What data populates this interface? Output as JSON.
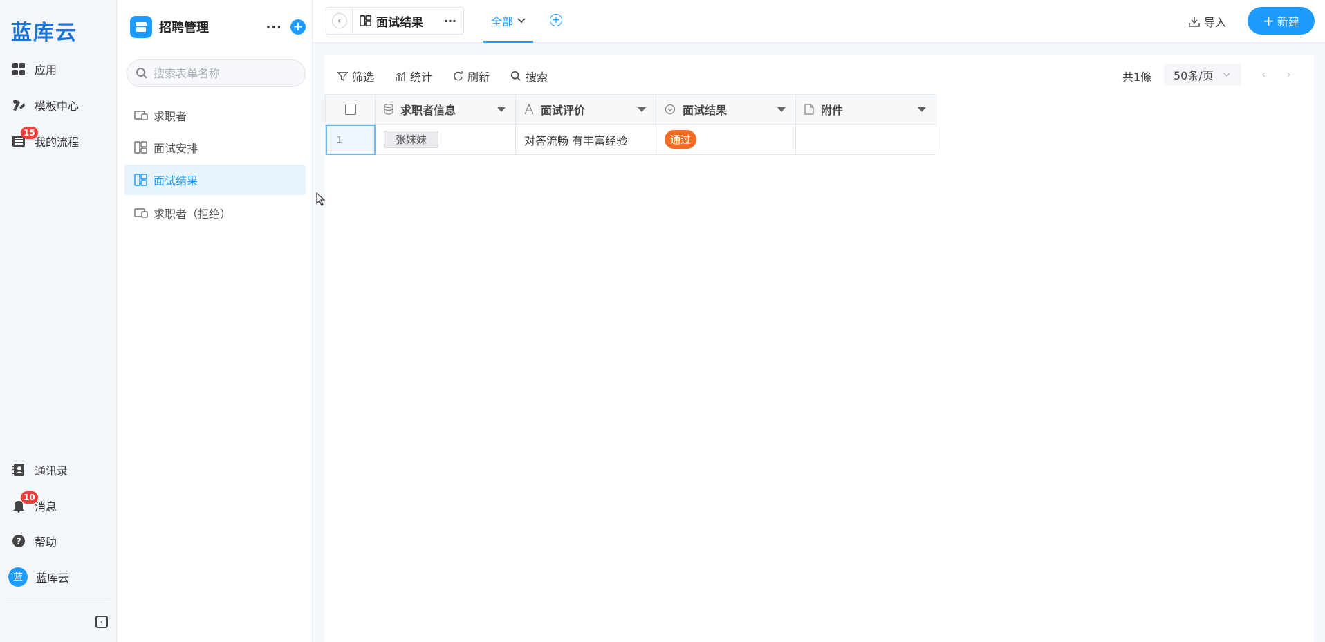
{
  "leftnav": {
    "logo": "蓝库云",
    "items": [
      {
        "label": "应用",
        "icon": "grid-icon"
      },
      {
        "label": "模板中心",
        "icon": "template-icon"
      },
      {
        "label": "我的流程",
        "icon": "list-icon",
        "badge": "15"
      }
    ],
    "bottom_items": [
      {
        "label": "通讯录",
        "icon": "contacts-icon"
      },
      {
        "label": "消息",
        "icon": "bell-icon",
        "badge": "10"
      },
      {
        "label": "帮助",
        "icon": "help-icon"
      }
    ],
    "user": {
      "avatar_text": "蓝",
      "name": "蓝库云"
    }
  },
  "sidebar": {
    "app_title": "招聘管理",
    "search_placeholder": "搜索表单名称",
    "forms": [
      {
        "label": "求职者",
        "active": false
      },
      {
        "label": "面试安排",
        "active": false
      },
      {
        "label": "面试结果",
        "active": true
      },
      {
        "label": "求职者（拒绝）",
        "active": false
      }
    ]
  },
  "topbar": {
    "form_title": "面试结果",
    "view_tab": "全部",
    "import_label": "导入",
    "new_label": "新建"
  },
  "toolbar": {
    "filter": "筛选",
    "stats": "统计",
    "refresh": "刷新",
    "search": "搜索",
    "total": "共1條",
    "page_size": "50条/页"
  },
  "table": {
    "columns": [
      {
        "label": "求职者信息",
        "icon": "database-icon"
      },
      {
        "label": "面试评价",
        "icon": "text-icon"
      },
      {
        "label": "面试结果",
        "icon": "select-icon"
      },
      {
        "label": "附件",
        "icon": "file-icon"
      }
    ],
    "rows": [
      {
        "num": "1",
        "applicant": "张妹妹",
        "evaluation": "对答流畅 有丰富经验",
        "result": "通过",
        "attachment": ""
      }
    ]
  },
  "colors": {
    "accent": "#1e9bff",
    "badge": "#f23c3c",
    "pass_tag": "#f36b24"
  }
}
